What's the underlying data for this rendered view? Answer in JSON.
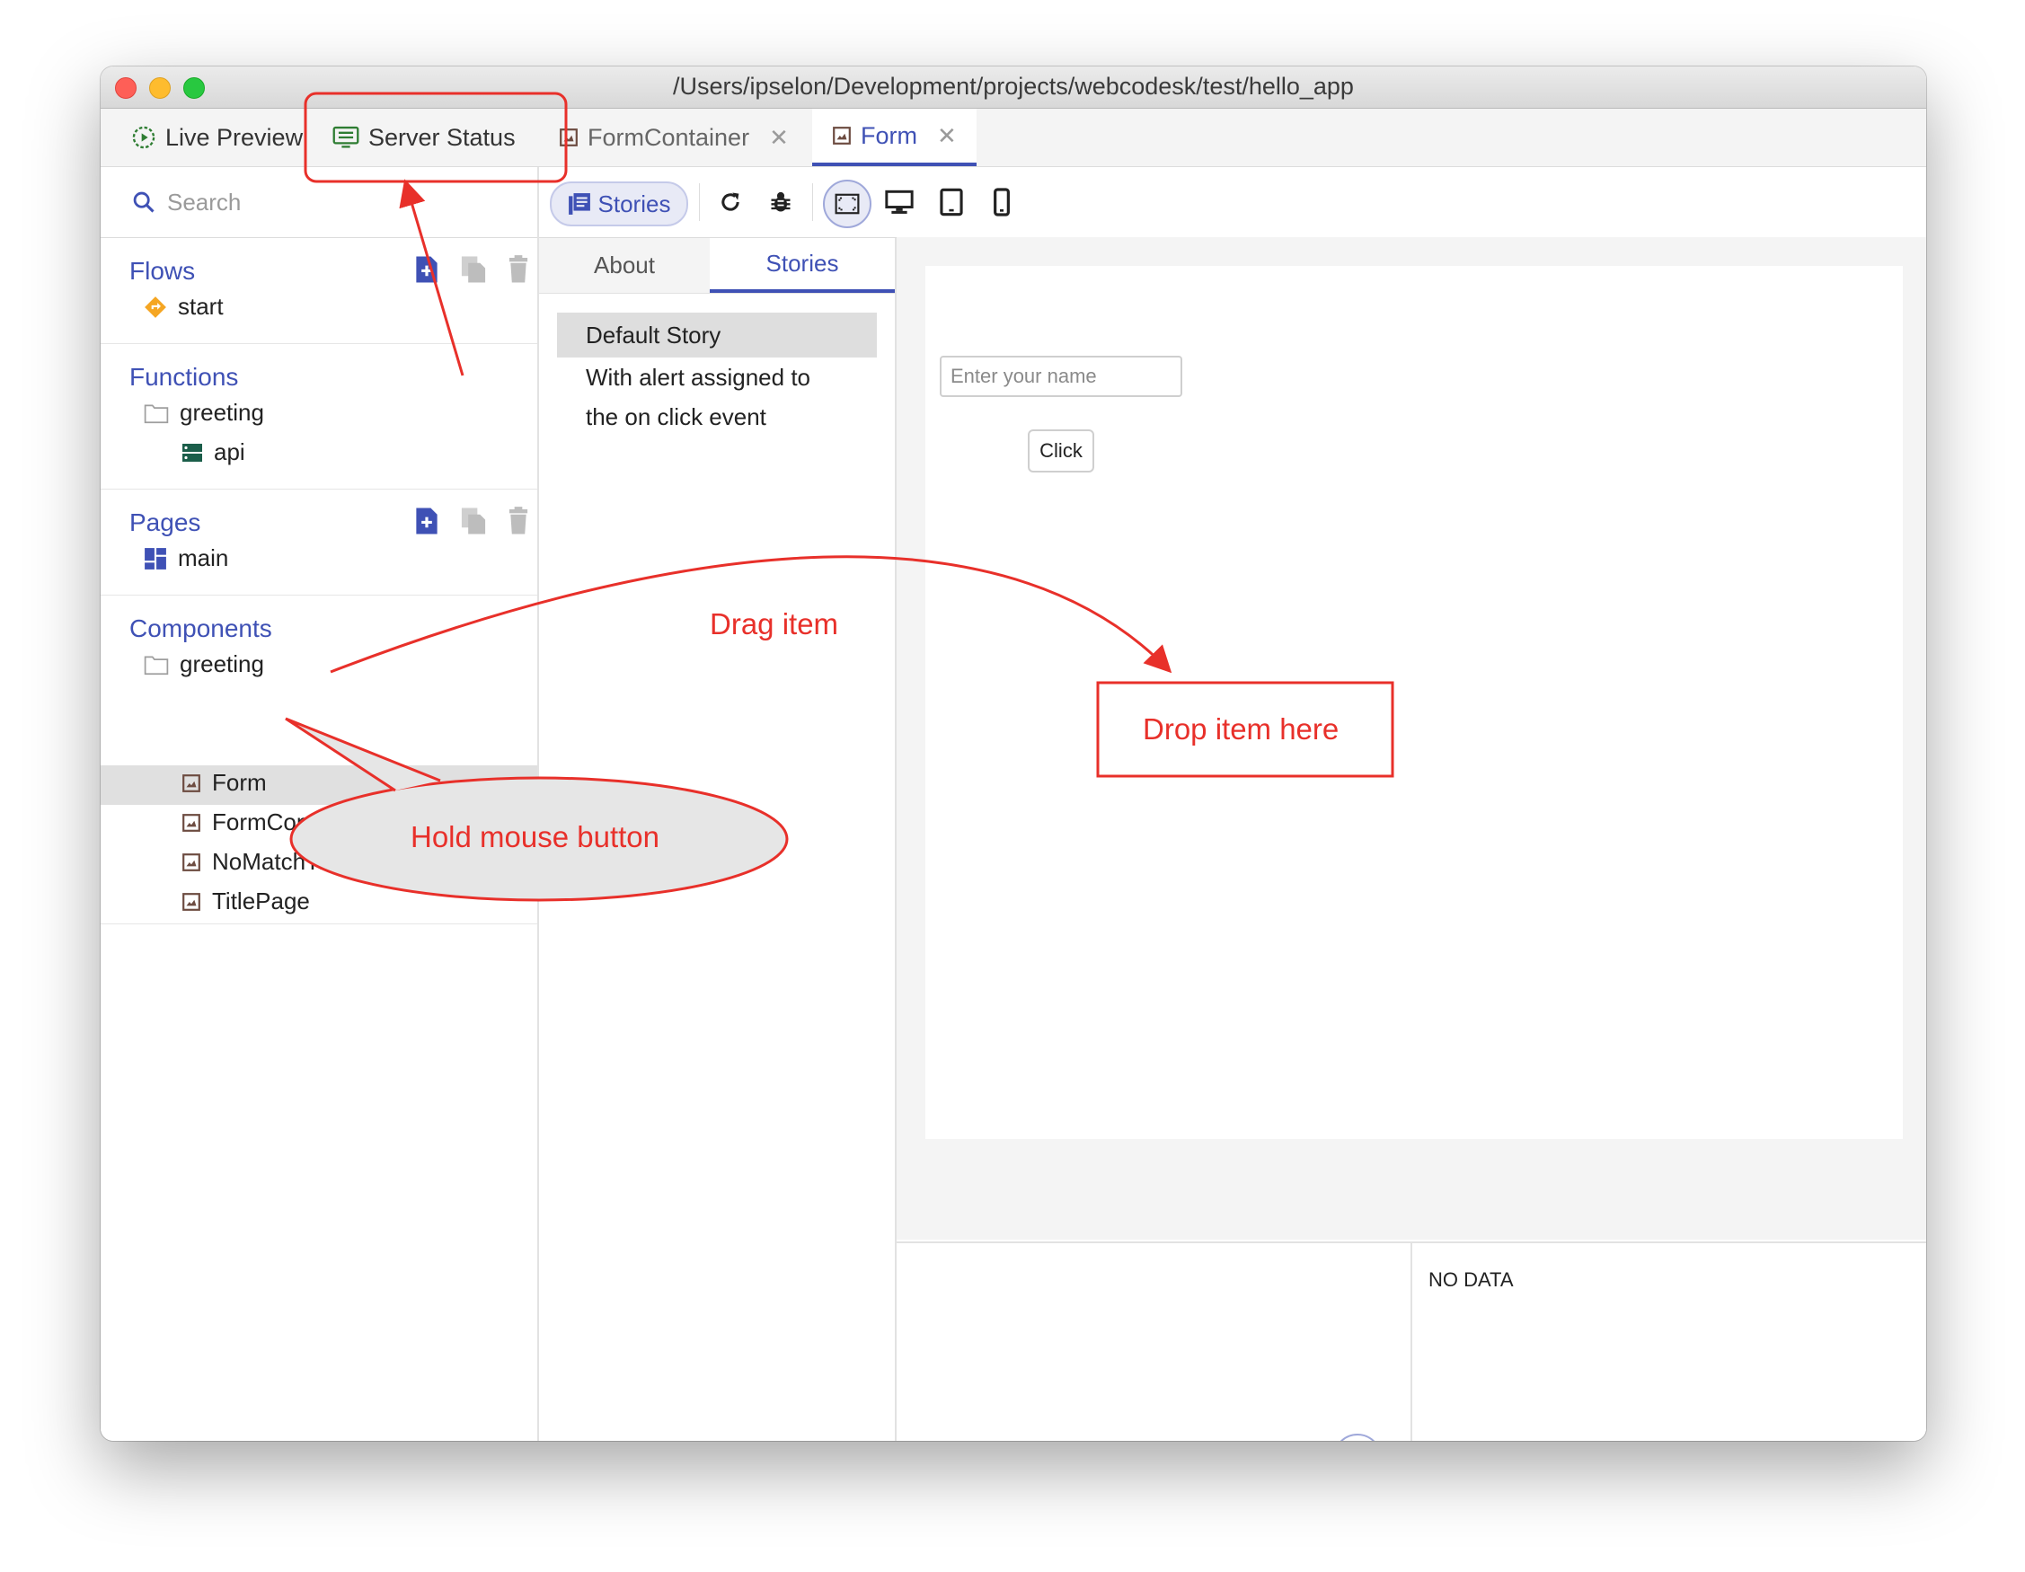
{
  "window": {
    "title": "/Users/ipselon/Development/projects/webcodesk/test/hello_app"
  },
  "tabs": [
    {
      "label": "Live Preview",
      "icon": "play-circle-icon"
    },
    {
      "label": "Server Status",
      "icon": "server-status-icon"
    },
    {
      "label": "FormContainer",
      "icon": "component-icon"
    },
    {
      "label": "Form",
      "icon": "component-icon"
    }
  ],
  "search": {
    "placeholder": "Search"
  },
  "sidebar": {
    "flows": {
      "title": "Flows",
      "items": [
        "start"
      ]
    },
    "functions": {
      "title": "Functions",
      "folder": "greeting",
      "items": [
        "api"
      ]
    },
    "pages": {
      "title": "Pages",
      "items": [
        "main"
      ]
    },
    "components": {
      "title": "Components",
      "folder": "greeting",
      "items": [
        "Form",
        "FormContainer",
        "NoMatchTitlePage",
        "TitlePage"
      ]
    }
  },
  "toolbar": {
    "stories_label": "Stories"
  },
  "subtabs": {
    "about": "About",
    "stories": "Stories"
  },
  "stories": [
    {
      "line1": "Default Story",
      "line2": ""
    },
    {
      "line1": "With alert assigned to",
      "line2": "the on click event"
    }
  ],
  "preview": {
    "input_placeholder": "Enter your name",
    "button_label": "Click"
  },
  "bottom": {
    "no_data": "NO DATA"
  },
  "annotations": {
    "drag": "Drag item",
    "drop": "Drop item here",
    "hold": "Hold mouse button"
  },
  "colors": {
    "accent": "#3f51b5",
    "annotation": "#e8302a",
    "server_icon": "#2e7d32",
    "flow_icon": "#f5a623"
  }
}
